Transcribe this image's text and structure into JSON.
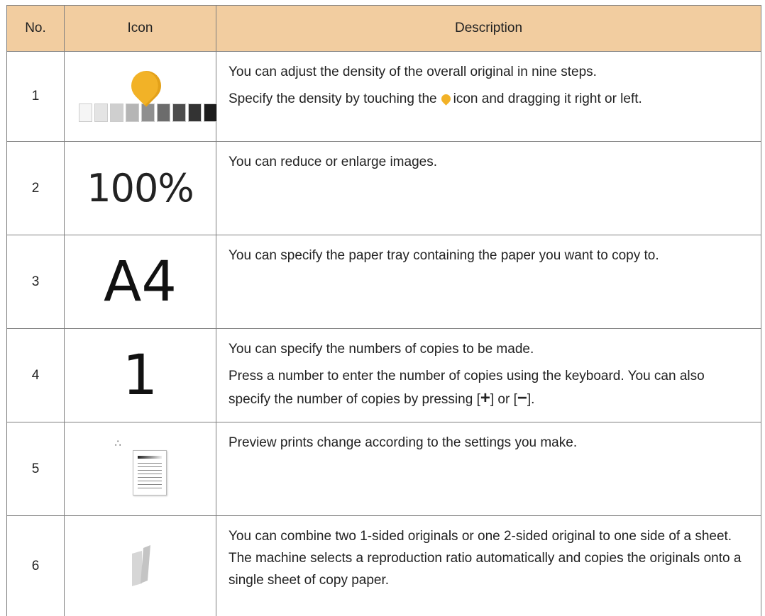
{
  "table": {
    "headers": {
      "no": "No.",
      "icon": "Icon",
      "description": "Description"
    },
    "rows": [
      {
        "no": "1",
        "icon": "density-slider-icon",
        "desc": [
          "You can adjust the density of the overall original in nine steps."
        ],
        "desc2_pre": "Specify the density by touching the",
        "desc2_post": "icon and dragging it right or left."
      },
      {
        "no": "2",
        "icon_text": "100%",
        "desc": [
          "You can reduce or enlarge images."
        ]
      },
      {
        "no": "3",
        "icon_text": "A4",
        "desc": [
          "You can specify the paper tray containing the paper you want to copy to."
        ]
      },
      {
        "no": "4",
        "icon_text": "1",
        "desc": [
          "You can specify the numbers of copies to be made."
        ],
        "desc2_pre": "Press a number to enter the number of copies using the keyboard. You can also specify the number of copies by pressing [",
        "desc2_mid": "] or [",
        "desc2_post": "].",
        "plus": "+",
        "minus": "−"
      },
      {
        "no": "5",
        "icon": "preview-icon",
        "desc": [
          "Preview prints change according to the settings you make."
        ]
      },
      {
        "no": "6",
        "icon": "combine-pages-icon",
        "desc": [
          "You can combine two 1-sided originals or one 2-sided original to one side of a sheet. The machine selects a reproduction ratio automatically and copies the originals onto a single sheet of copy paper."
        ]
      }
    ]
  },
  "colors": {
    "header_bg": "#f2cda0",
    "border": "#7f7f7f",
    "pin": "#f2b227",
    "density_steps": [
      "#f5f5f5",
      "#e4e4e4",
      "#cfcfcf",
      "#b5b5b5",
      "#8f8f8f",
      "#6c6c6c",
      "#4c4c4c",
      "#333333",
      "#1c1c1c"
    ]
  }
}
